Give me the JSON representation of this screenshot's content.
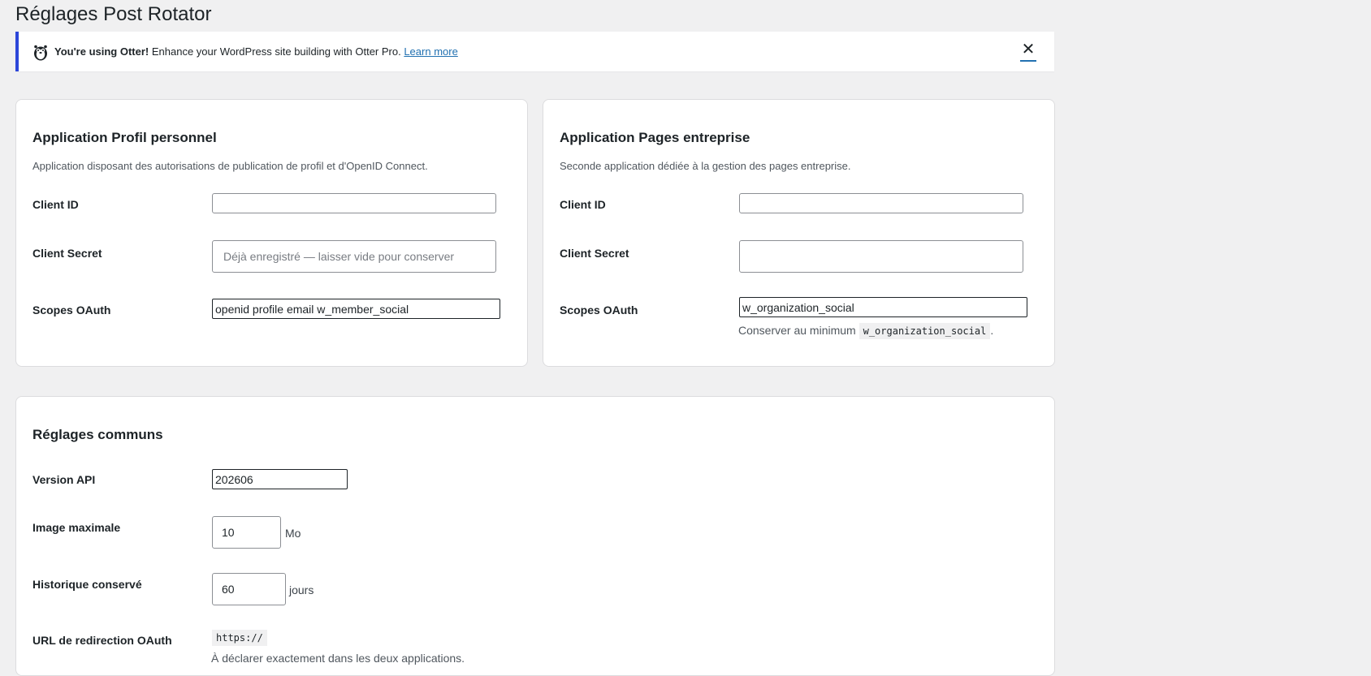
{
  "page": {
    "title": "Réglages Post Rotator"
  },
  "notice": {
    "icon": "otter-icon",
    "brand": "You're using Otter!",
    "text": " Enhance your WordPress site building with Otter Pro. ",
    "link": "Learn more",
    "close": "✕",
    "accent": "#2c46d9"
  },
  "personal_app": {
    "title": "Application Profil personnel",
    "description": "Application disposant des autorisations de publication de profil et d'OpenID Connect.",
    "client_id": {
      "label": "Client ID",
      "value": ""
    },
    "client_secret": {
      "label": "Client Secret",
      "value": "",
      "placeholder": "Déjà enregistré — laisser vide pour conserver"
    },
    "scopes": {
      "label": "Scopes OAuth",
      "value": "openid profile email w_member_social"
    }
  },
  "company_app": {
    "title": "Application Pages entreprise",
    "description": "Seconde application dédiée à la gestion des pages entreprise.",
    "client_id": {
      "label": "Client ID",
      "value": ""
    },
    "client_secret": {
      "label": "Client Secret",
      "value": "",
      "placeholder": ""
    },
    "scopes": {
      "label": "Scopes OAuth",
      "value": "w_organization_social"
    },
    "hint_prefix": "Conserver au minimum ",
    "hint_code": "w_organization_social",
    "hint_suffix": "."
  },
  "common": {
    "title": "Réglages communs",
    "api_version": {
      "label": "Version API",
      "value": "202606"
    },
    "max_image": {
      "label": "Image maximale",
      "value": "10",
      "unit": "Mo"
    },
    "history": {
      "label": "Historique conservé",
      "value": "60",
      "unit": "jours"
    },
    "redirect": {
      "label": "URL de redirection OAuth",
      "code": "https://",
      "hint": "À déclarer exactement dans les deux applications."
    }
  }
}
